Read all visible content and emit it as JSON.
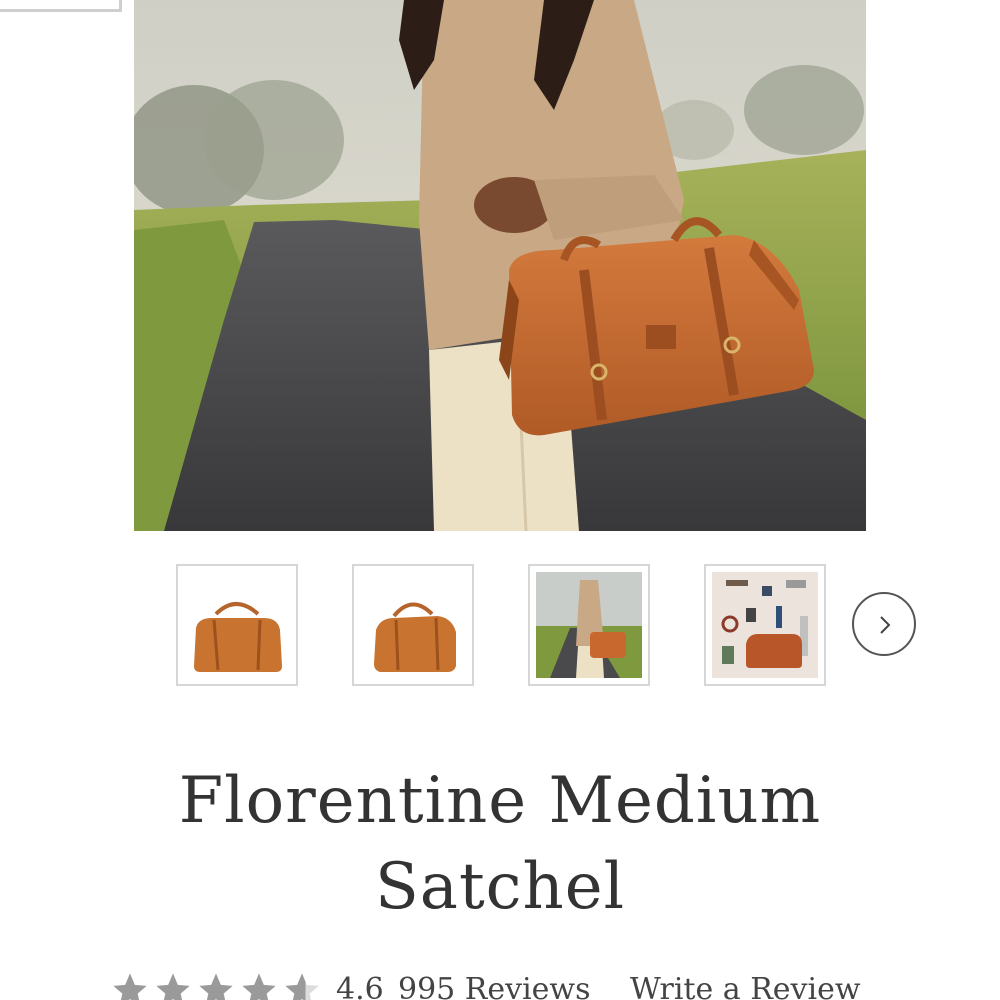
{
  "product": {
    "title": "Florentine Medium Satchel",
    "rating": "4.6",
    "reviews_label": "995 Reviews",
    "write_review_label": "Write a Review",
    "star_rating_value": 4.6,
    "star_count": 5
  },
  "gallery": {
    "thumbnail_count": 4,
    "next_icon": "chevron-right-icon"
  },
  "colors": {
    "bag_tan": "#c4682f",
    "text": "#333333",
    "star_gray": "#9a9a9a",
    "thumb_border": "#d6d6d6"
  }
}
